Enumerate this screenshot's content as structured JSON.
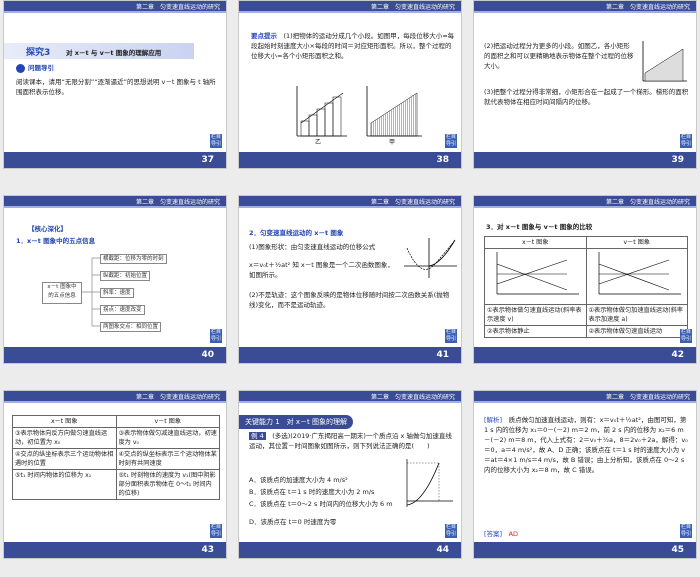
{
  "slides": [
    {
      "num": "37",
      "header": "第二章　匀变速直线运动的研究",
      "title_a": "探究3",
      "title_b": "对 x－t 与 v－t 图象的理解应用",
      "guide": "问题导引",
      "body": "阅读课本，请用“无限分割”“逐渐逼近”的思想说明 v－t 图象与 t 轴所围面积表示位移。"
    },
    {
      "num": "38",
      "header": "第二章　匀变速直线运动的研究",
      "label": "要点提示",
      "body": "(1)把物体的运动分成几个小段。如图甲，每段位移大小≈每段起始时刻速度大小×每段的时间＝对应矩形面积。所以，整个过程的位移大小≈各个小矩形面积之和。",
      "caption_a": "甲",
      "caption_b": "乙"
    },
    {
      "num": "39",
      "header": "第二章　匀变速直线运动的研究",
      "p1": "(2)把运动过程分为更多的小段。如图乙，各小矩形的面积之和可以更精确地表示物体在整个过程的位移大小。",
      "p2": "(3)把整个过程分得非常细，小矩形合在一起成了一个梯形。梯形的面积就代表物体在相应时间间隔内的位移。"
    },
    {
      "num": "40",
      "header": "第二章　匀变速直线运动的研究",
      "title": "【核心深化】",
      "sub": "1．x－t 图象中的五点信息",
      "center": "x－t 图象中的五点信息",
      "items": [
        "横截距：位移为零的时刻",
        "纵截距：初始位置",
        "斜率：速度",
        "拐点：速度改变",
        "两图象交点：相同位置"
      ]
    },
    {
      "num": "41",
      "header": "第二章　匀变速直线运动的研究",
      "sub": "2．匀变速直线运动的 x－t 图象",
      "p1": "(1)图象形状：由匀变速直线运动的位移公式",
      "p2": "x＝v₀t＋½at² 知 x－t 图象是一个二次函数图象，如图所示。",
      "p3": "(2)不是轨迹：这个图象反映的是物体位移随时间按二次函数关系(抛物线)变化，而不是运动轨迹。"
    },
    {
      "num": "42",
      "header": "第二章　匀变速直线运动的研究",
      "sub": "3．对 x－t 图象与 v－t 图象的比较",
      "col1": "x－t 图象",
      "col2": "v－t 图象",
      "r1c1": "①表示物体做匀速直线运动(斜率表示速度 v)",
      "r1c2": "①表示物体做匀加速直线运动(斜率表示加速度 a)",
      "r2c1": "②表示物体静止",
      "r2c2": "②表示物体做匀速直线运动"
    },
    {
      "num": "43",
      "header": "第二章　匀变速直线运动的研究",
      "col1": "x－t 图象",
      "col2": "v－t 图象",
      "rows": [
        [
          "③表示物体向反方向做匀速直线运动，初位置为 x₀",
          "③表示物体做匀减速直线运动，初速度为 v₀"
        ],
        [
          "④交点的纵坐标表示三个运动物体相遇时的位置",
          "④交点的纵坐标表示三个运动物体某时刻有共同速度"
        ],
        [
          "⑤t₁ 时间内物体的位移为 x₁",
          "⑤t₁ 时刻物体的速度为 v₁(图中阴影部分面积表示物体在 0～t₁ 时间内的位移)"
        ]
      ]
    },
    {
      "num": "44",
      "header": "第二章　匀变速直线运动的研究",
      "bar": "关键能力 1　对 x－t 图象的理解",
      "ex": "例 4",
      "body": "(多选)(2019·广东揭阳高一期末)一个质点沿 x 轴做匀加速直线运动，其位置－时间图象如图所示，则下列说法正确的是(　　)",
      "opts": [
        "A．该质点的加速度大小为 4 m/s²",
        "B．该质点在 t＝1 s 时的速度大小为 2 m/s",
        "C．该质点在 t＝0～2 s 时间内的位移大小为 6 m",
        "D．该质点在 t＝0 时速度为零"
      ]
    },
    {
      "num": "45",
      "header": "第二章　匀变速直线运动的研究",
      "jx": "[解析]",
      "body": "质点做匀加速直线运动，则有：x＝v₀t＋½at²，由图可知，第 1 s 内的位移为 x₁＝0－(－2) m＝2 m，前 2 s 内的位移为 x₂＝6 m－(－2) m＝8 m，代入上式有：2＝v₀＋½a，8＝2v₀＋2a，解得：v₀＝0，a＝4 m/s²，故 A、D 正确；该质点在 t＝1 s 时的速度大小为 v＝at＝4×1 m/s＝4 m/s，故 B 错误；由上分析知，该质点在 0～2 s 内的位移大小为 x₂＝8 m，故 C 错误。",
      "ans_label": "[答案]",
      "ans": "AD"
    }
  ],
  "back_label": "栏目导引"
}
